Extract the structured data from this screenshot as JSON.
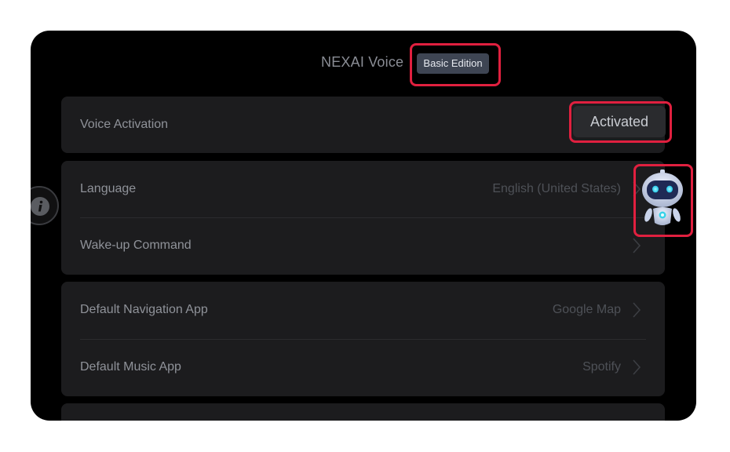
{
  "header": {
    "title": "NEXAI Voice",
    "edition_badge": "Basic Edition"
  },
  "voice_activation": {
    "label": "Voice Activation",
    "button_label": "Activated"
  },
  "language_group": {
    "language": {
      "label": "Language",
      "value": "English (United States)"
    },
    "wakeup": {
      "label": "Wake-up Command",
      "value": ""
    }
  },
  "apps_group": {
    "navigation": {
      "label": "Default Navigation App",
      "value": "Google Map"
    },
    "music": {
      "label": "Default Music App",
      "value": "Spotify"
    }
  },
  "icons": {
    "info": "info-icon",
    "chevron": "chevron-right-icon",
    "assistant": "robot-assistant-icon"
  },
  "colors": {
    "background": "#000000",
    "card": "#1c1c1e",
    "badge": "#3e4553",
    "highlight": "#e0203f",
    "text_primary": "#8f9299",
    "text_secondary": "#4e5157"
  }
}
